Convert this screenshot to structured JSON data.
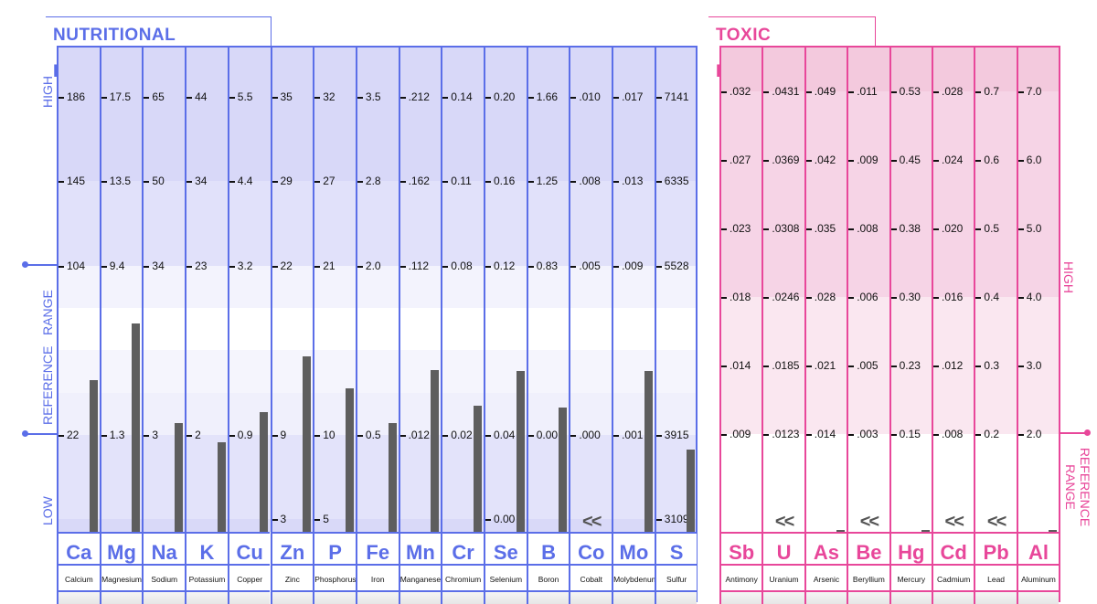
{
  "colors": {
    "nutritional": "#5b6ee8",
    "toxic": "#e8479a",
    "bar": "#5e5e5e"
  },
  "nutritional": {
    "title": "NUTRITIONAL ELEMENTS",
    "side_labels": {
      "high": "HIGH",
      "reference": "REFERENCE   RANGE",
      "low": "LOW"
    },
    "elements": [
      {
        "symbol": "Ca",
        "name": "Calcium",
        "ticks": [
          "186",
          "145",
          "104",
          "",
          "22",
          ""
        ],
        "level": 0.313
      },
      {
        "symbol": "Mg",
        "name": "Magnesium",
        "ticks": [
          "17.5",
          "13.5",
          "9.4",
          "",
          "1.3",
          ""
        ],
        "level": 0.43
      },
      {
        "symbol": "Na",
        "name": "Sodium",
        "ticks": [
          "65",
          "50",
          "34",
          "",
          "3",
          ""
        ],
        "level": 0.225
      },
      {
        "symbol": "K",
        "name": "Potassium",
        "ticks": [
          "44",
          "34",
          "23",
          "",
          "2",
          ""
        ],
        "level": 0.185
      },
      {
        "symbol": "Cu",
        "name": "Copper",
        "ticks": [
          "5.5",
          "4.4",
          "3.2",
          "",
          "0.9",
          ""
        ],
        "level": 0.247
      },
      {
        "symbol": "Zn",
        "name": "Zinc",
        "ticks": [
          "35",
          "29",
          "22",
          "",
          "9",
          "3"
        ],
        "level": 0.362
      },
      {
        "symbol": "P",
        "name": "Phosphorus",
        "ticks": [
          "32",
          "27",
          "21",
          "",
          "10",
          "5"
        ],
        "level": 0.296
      },
      {
        "symbol": "Fe",
        "name": "Iron",
        "ticks": [
          "3.5",
          "2.8",
          "2.0",
          "",
          "0.5",
          ""
        ],
        "level": 0.225
      },
      {
        "symbol": "Mn",
        "name": "Manganese",
        "ticks": [
          ".212",
          ".162",
          ".112",
          "",
          ".012",
          ""
        ],
        "level": 0.334
      },
      {
        "symbol": "Cr",
        "name": "Chromium",
        "ticks": [
          "0.14",
          "0.11",
          "0.08",
          "",
          "0.02",
          ""
        ],
        "level": 0.26
      },
      {
        "symbol": "Se",
        "name": "Selenium",
        "ticks": [
          "0.20",
          "0.16",
          "0.12",
          "",
          "0.04",
          "0.00"
        ],
        "level": 0.332
      },
      {
        "symbol": "B",
        "name": "Boron",
        "ticks": [
          "1.66",
          "1.25",
          "0.83",
          "",
          "0.00",
          ""
        ],
        "level": 0.257
      },
      {
        "symbol": "Co",
        "name": "Cobalt",
        "ticks": [
          ".010",
          ".008",
          ".005",
          "",
          ".000",
          ""
        ],
        "level": 0,
        "below": "<<"
      },
      {
        "symbol": "Mo",
        "name": "Molybdenum",
        "ticks": [
          ".017",
          ".013",
          ".009",
          "",
          ".001",
          ""
        ],
        "level": 0.332
      },
      {
        "symbol": "S",
        "name": "Sulfur",
        "ticks": [
          "7141",
          "6335",
          "5528",
          "",
          "3915",
          "3109"
        ],
        "level": 0.17
      }
    ]
  },
  "toxic": {
    "title": "TOXIC ELEMENTS",
    "side_labels": {
      "high": "HIGH",
      "reference": "REFERENCE RANGE"
    },
    "elements": [
      {
        "symbol": "Sb",
        "name": "Antimony",
        "ticks": [
          ".032",
          ".027",
          ".023",
          ".018",
          ".014",
          ".009"
        ],
        "level": 0
      },
      {
        "symbol": "U",
        "name": "Uranium",
        "ticks": [
          ".0431",
          ".0369",
          ".0308",
          ".0246",
          ".0185",
          ".0123"
        ],
        "level": 0,
        "below": "<<"
      },
      {
        "symbol": "As",
        "name": "Arsenic",
        "ticks": [
          ".049",
          ".042",
          ".035",
          ".028",
          ".021",
          ".014"
        ],
        "level": 0.004
      },
      {
        "symbol": "Be",
        "name": "Beryllium",
        "ticks": [
          ".011",
          ".009",
          ".008",
          ".006",
          ".005",
          ".003"
        ],
        "level": 0,
        "below": "<<"
      },
      {
        "symbol": "Hg",
        "name": "Mercury",
        "ticks": [
          "0.53",
          "0.45",
          "0.38",
          "0.30",
          "0.23",
          "0.15"
        ],
        "level": 0.004
      },
      {
        "symbol": "Cd",
        "name": "Cadmium",
        "ticks": [
          ".028",
          ".024",
          ".020",
          ".016",
          ".012",
          ".008"
        ],
        "level": 0,
        "below": "<<"
      },
      {
        "symbol": "Pb",
        "name": "Lead",
        "ticks": [
          "0.7",
          "0.6",
          "0.5",
          "0.4",
          "0.3",
          "0.2"
        ],
        "level": 0,
        "below": "<<"
      },
      {
        "symbol": "Al",
        "name": "Aluminum",
        "ticks": [
          "7.0",
          "6.0",
          "5.0",
          "4.0",
          "3.0",
          "2.0"
        ],
        "level": 0.004
      }
    ]
  },
  "chart_data": {
    "type": "bar",
    "categories": [
      "Ca",
      "Mg",
      "Na",
      "K",
      "Cu",
      "Zn",
      "P",
      "Fe",
      "Mn",
      "Cr",
      "Se",
      "B",
      "Co",
      "Mo",
      "S",
      "Sb",
      "U",
      "As",
      "Be",
      "Hg",
      "Cd",
      "Pb",
      "Al"
    ],
    "values_fraction_of_scale": [
      0.313,
      0.43,
      0.225,
      0.185,
      0.247,
      0.362,
      0.296,
      0.225,
      0.334,
      0.26,
      0.332,
      0.257,
      0,
      0.332,
      0.17,
      0,
      0,
      0.004,
      0,
      0.004,
      0,
      0,
      0.004
    ],
    "grid": true,
    "legend": "none"
  }
}
